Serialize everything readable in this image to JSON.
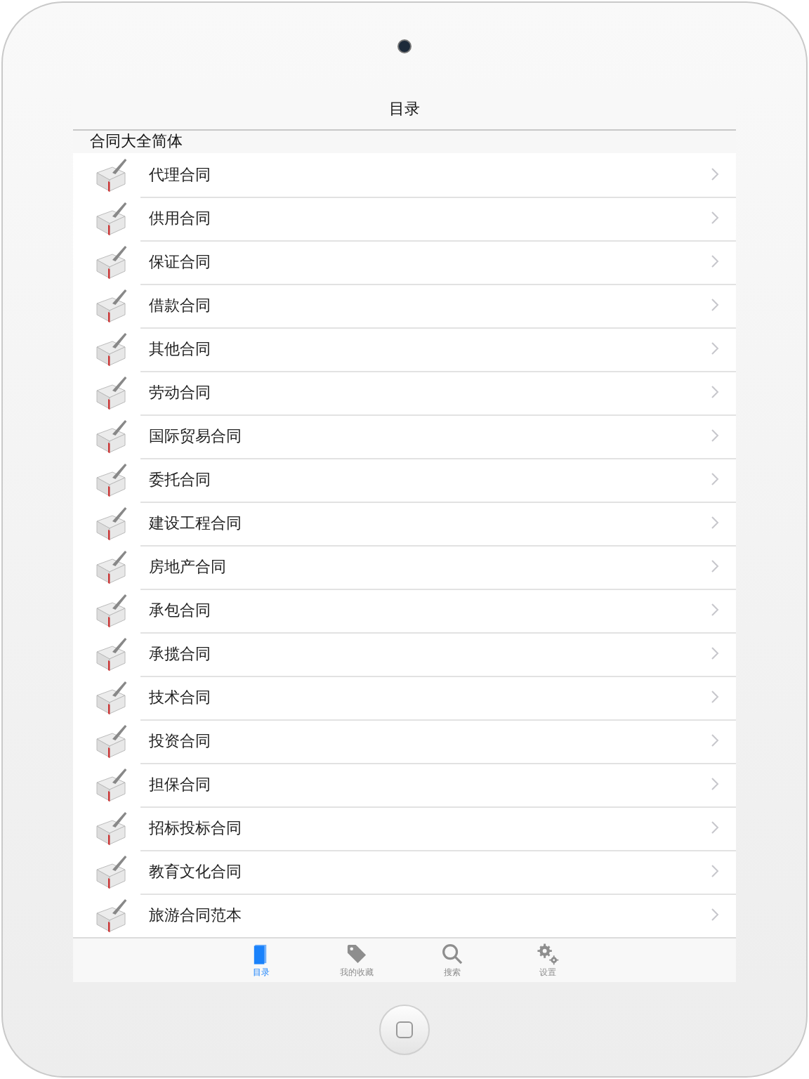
{
  "nav_bar": {
    "title": "目录"
  },
  "list": {
    "section_header": "合同大全简体",
    "rows": [
      {
        "label": "代理合同"
      },
      {
        "label": "供用合同"
      },
      {
        "label": "保证合同"
      },
      {
        "label": "借款合同"
      },
      {
        "label": "其他合同"
      },
      {
        "label": "劳动合同"
      },
      {
        "label": "国际贸易合同"
      },
      {
        "label": "委托合同"
      },
      {
        "label": "建设工程合同"
      },
      {
        "label": "房地产合同"
      },
      {
        "label": "承包合同"
      },
      {
        "label": "承揽合同"
      },
      {
        "label": "技术合同"
      },
      {
        "label": "投资合同"
      },
      {
        "label": "担保合同"
      },
      {
        "label": "招标投标合同"
      },
      {
        "label": "教育文化合同"
      },
      {
        "label": "旅游合同范本"
      }
    ]
  },
  "tab_bar": [
    {
      "kind": "book",
      "label": "目录",
      "selected": true
    },
    {
      "kind": "tag",
      "label": "我的收藏",
      "selected": false
    },
    {
      "kind": "search",
      "label": "搜索",
      "selected": false
    },
    {
      "kind": "gear",
      "label": "设置",
      "selected": false
    }
  ]
}
